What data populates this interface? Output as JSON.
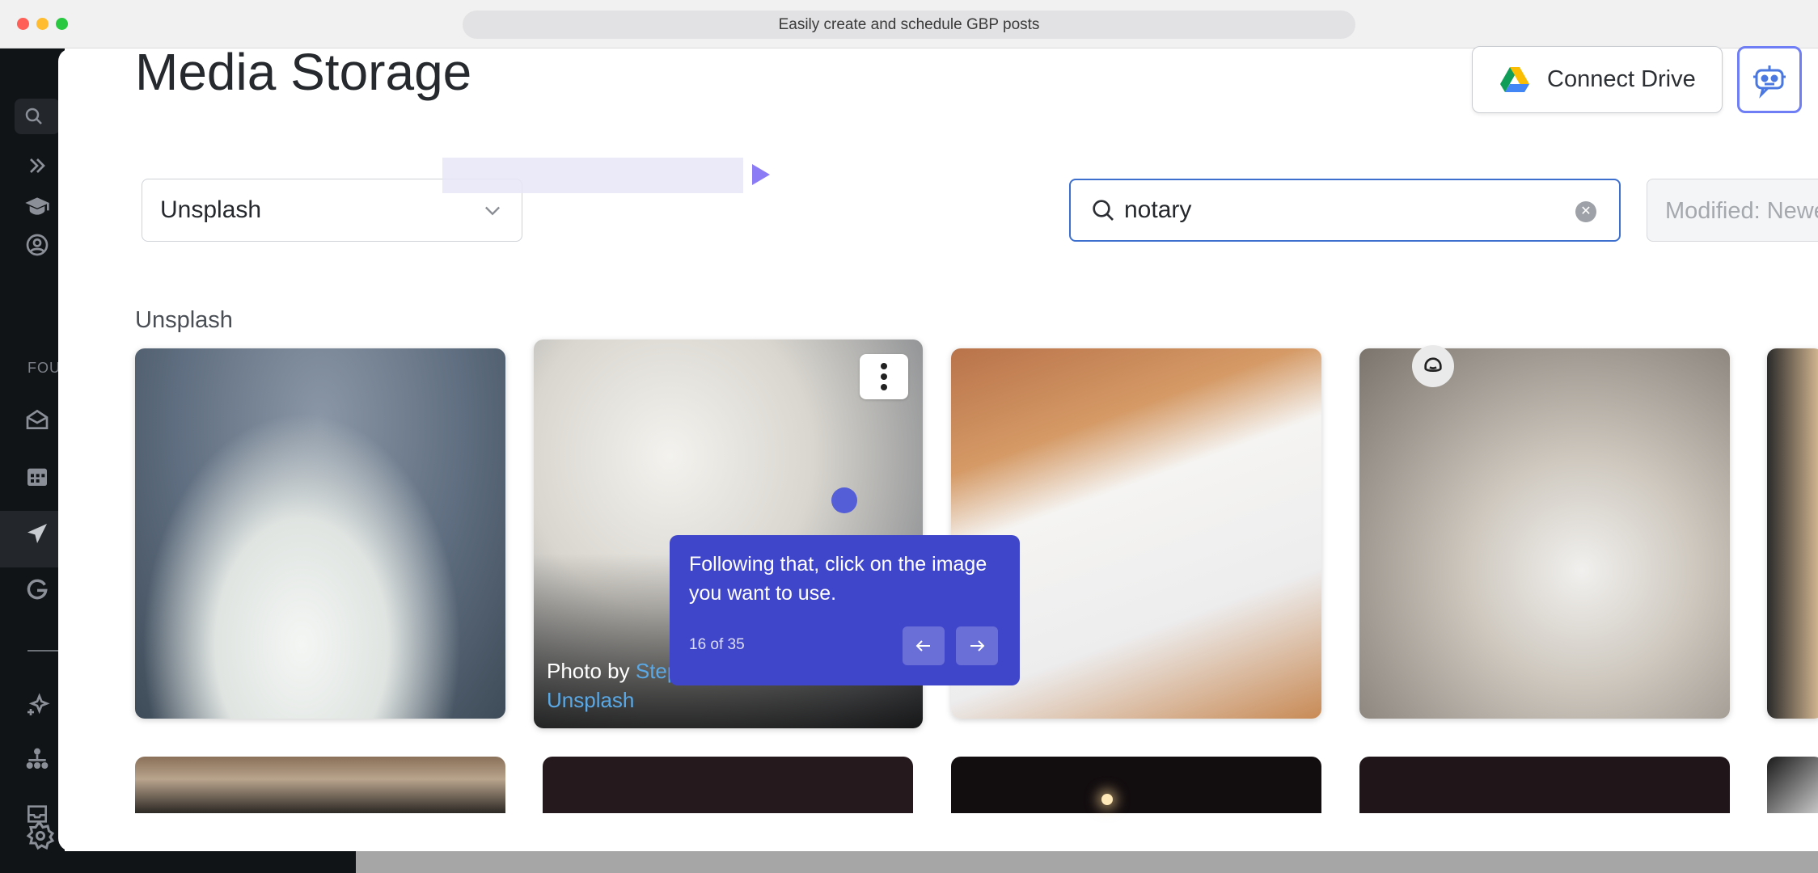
{
  "browser": {
    "url_title": "Easily create and schedule GBP posts"
  },
  "sidebar": {
    "section_label": "FOU",
    "icons": [
      "search-icon",
      "expand-icon",
      "academy-icon",
      "account-icon",
      "inbox-icon",
      "calendar-icon",
      "send-icon",
      "google-icon",
      "sparkle-icon",
      "org-chart-icon",
      "tray-icon",
      "settings-icon"
    ]
  },
  "header": {
    "title": "Media Storage",
    "connect_drive_label": "Connect Drive"
  },
  "filters": {
    "source_selected": "Unsplash",
    "search_value": "notary",
    "sort_label": "Modified: Newest"
  },
  "section": {
    "title": "Unsplash"
  },
  "card2": {
    "credit_prefix": "Photo by ",
    "credit_name_partial": "Step",
    "credit_site": "Unsplash"
  },
  "tooltip": {
    "text": "Following that, click on the image you want to use.",
    "progress": "16 of 35"
  },
  "colors": {
    "accent": "#4046c9",
    "search_border": "#3d6fce",
    "sidebar": "#111417"
  }
}
